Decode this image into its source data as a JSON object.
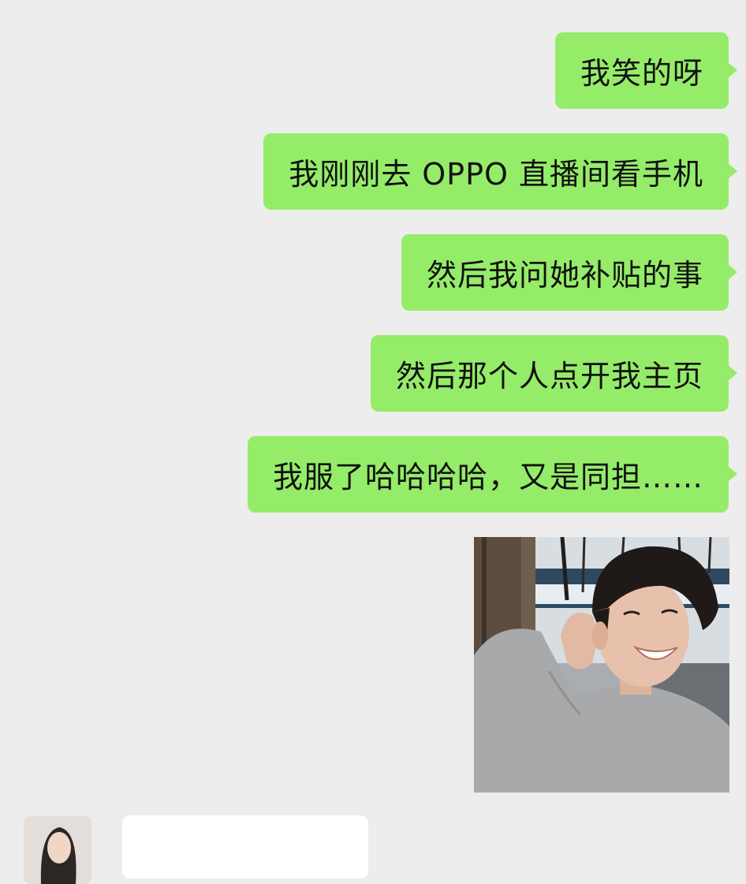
{
  "messages": [
    {
      "side": "outgoing",
      "text": "我笑的呀"
    },
    {
      "side": "outgoing",
      "text": "我刚刚去 OPPO 直播间看手机"
    },
    {
      "side": "outgoing",
      "text": "然后我问她补贴的事"
    },
    {
      "side": "outgoing",
      "text": "然后那个人点开我主页"
    },
    {
      "side": "outgoing",
      "text": "我服了哈哈哈哈，又是同担……"
    }
  ],
  "image_message": {
    "icon": "smiling-person-photo"
  },
  "incoming": {
    "icon": "avatar"
  },
  "colors": {
    "background": "#ededed",
    "outgoing_bubble": "#95ec69",
    "incoming_bubble": "#ffffff",
    "text": "#111111"
  }
}
